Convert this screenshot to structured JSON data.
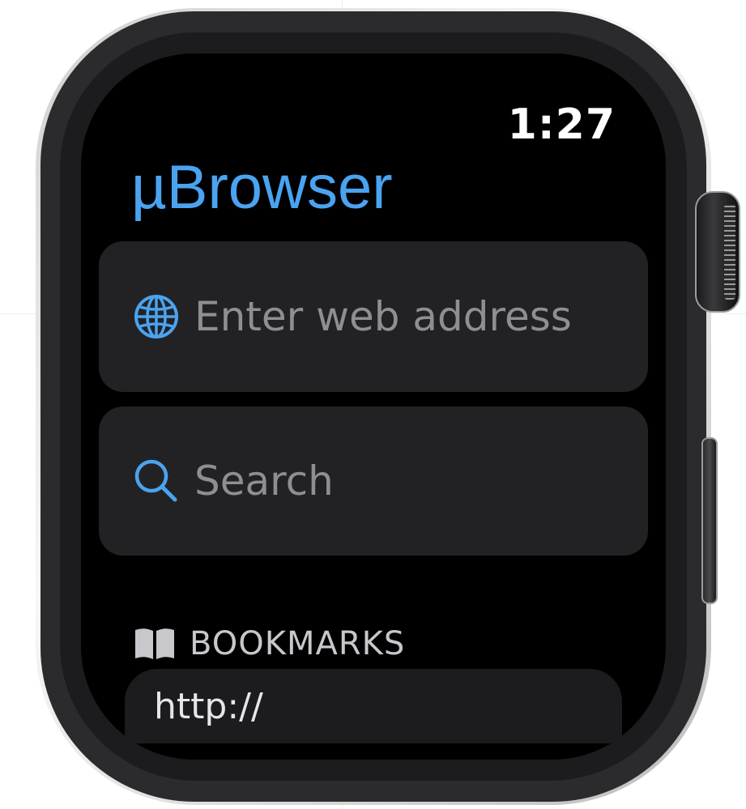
{
  "status_bar": {
    "time": "1:27"
  },
  "app": {
    "title": "µBrowser"
  },
  "address_field": {
    "icon": "globe-icon",
    "placeholder": "Enter web address"
  },
  "search_field": {
    "icon": "magnifying-glass-icon",
    "placeholder": "Search"
  },
  "bookmarks": {
    "icon": "book-icon",
    "header": "BOOKMARKS",
    "items": [
      {
        "url": "http://"
      }
    ]
  },
  "colors": {
    "accent": "#4aa3f0",
    "screen_background": "#000000",
    "card_background": "#222224",
    "placeholder_text": "#8e8e93"
  }
}
